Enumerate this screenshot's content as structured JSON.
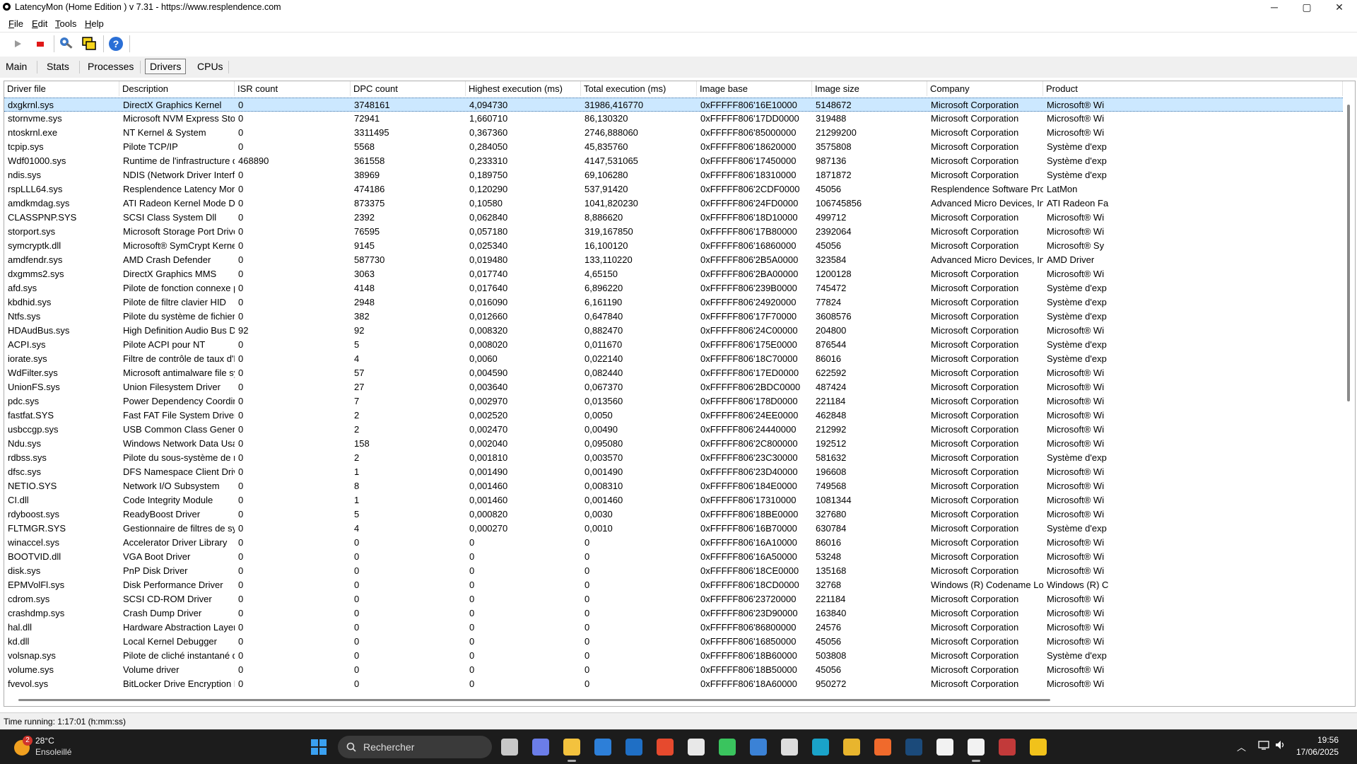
{
  "window": {
    "title": "LatencyMon  (Home Edition )  v 7.31 - https://www.resplendence.com",
    "minimize": "─",
    "maximize": "▢",
    "close": "✕"
  },
  "menu": [
    {
      "u": "F",
      "rest": "ile"
    },
    {
      "u": "E",
      "rest": "dit"
    },
    {
      "u": "T",
      "rest": "ools"
    },
    {
      "u": "H",
      "rest": "elp"
    }
  ],
  "toolbar": {
    "icons": [
      "play-icon",
      "stop-icon",
      "gear-wrench-icon",
      "copy-windows-icon",
      "help-icon"
    ]
  },
  "tabs": [
    {
      "label": "Main",
      "active": false
    },
    {
      "label": "Stats",
      "active": false
    },
    {
      "label": "Processes",
      "active": false
    },
    {
      "label": "Drivers",
      "active": true
    },
    {
      "label": "CPUs",
      "active": false
    }
  ],
  "columns": [
    "Driver file",
    "Description",
    "ISR count",
    "DPC count",
    "Highest execution (ms)",
    "Total execution (ms)",
    "Image base",
    "Image size",
    "Company",
    "Product"
  ],
  "rows": [
    [
      "dxgkrnl.sys",
      "DirectX Graphics Kernel",
      "0",
      "3748161",
      "4,094730",
      "31986,416770",
      "0xFFFFF806'16E10000",
      "5148672",
      "Microsoft Corporation",
      "Microsoft® Wi"
    ],
    [
      "stornvme.sys",
      "Microsoft NVM Express Storp...",
      "0",
      "72941",
      "1,660710",
      "86,130320",
      "0xFFFFF806'17DD0000",
      "319488",
      "Microsoft Corporation",
      "Microsoft® Wi"
    ],
    [
      "ntoskrnl.exe",
      "NT Kernel & System",
      "0",
      "3311495",
      "0,367360",
      "2746,888060",
      "0xFFFFF806'85000000",
      "21299200",
      "Microsoft Corporation",
      "Microsoft® Wi"
    ],
    [
      "tcpip.sys",
      "Pilote TCP/IP",
      "0",
      "5568",
      "0,284050",
      "45,835760",
      "0xFFFFF806'18620000",
      "3575808",
      "Microsoft Corporation",
      "Système d'exp"
    ],
    [
      "Wdf01000.sys",
      "Runtime de l'infrastructure de ...",
      "468890",
      "361558",
      "0,233310",
      "4147,531065",
      "0xFFFFF806'17450000",
      "987136",
      "Microsoft Corporation",
      "Système d'exp"
    ],
    [
      "ndis.sys",
      "NDIS (Network Driver Interface...",
      "0",
      "38969",
      "0,189750",
      "69,106280",
      "0xFFFFF806'18310000",
      "1871872",
      "Microsoft Corporation",
      "Système d'exp"
    ],
    [
      "rspLLL64.sys",
      "Resplendence Latency Monit...",
      "0",
      "474186",
      "0,120290",
      "537,91420",
      "0xFFFFF806'2CDF0000",
      "45056",
      "Resplendence Software Proje...",
      "LatMon"
    ],
    [
      "amdkmdag.sys",
      "ATI Radeon Kernel Mode Driver",
      "0",
      "873375",
      "0,10580",
      "1041,820230",
      "0xFFFFF806'24FD0000",
      "106745856",
      "Advanced Micro Devices, Inc.",
      "ATI Radeon Fa"
    ],
    [
      "CLASSPNP.SYS",
      "SCSI Class System Dll",
      "0",
      "2392",
      "0,062840",
      "8,886620",
      "0xFFFFF806'18D10000",
      "499712",
      "Microsoft Corporation",
      "Microsoft® Wi"
    ],
    [
      "storport.sys",
      "Microsoft Storage Port Driver",
      "0",
      "76595",
      "0,057180",
      "319,167850",
      "0xFFFFF806'17B80000",
      "2392064",
      "Microsoft Corporation",
      "Microsoft® Wi"
    ],
    [
      "symcryptk.dll",
      "Microsoft® SymCrypt Kernel ...",
      "0",
      "9145",
      "0,025340",
      "16,100120",
      "0xFFFFF806'16860000",
      "45056",
      "Microsoft Corporation",
      "Microsoft® Sy"
    ],
    [
      "amdfendr.sys",
      "AMD Crash Defender",
      "0",
      "587730",
      "0,019480",
      "133,110220",
      "0xFFFFF806'2B5A0000",
      "323584",
      "Advanced Micro Devices, Inc.",
      "AMD Driver"
    ],
    [
      "dxgmms2.sys",
      "DirectX Graphics MMS",
      "0",
      "3063",
      "0,017740",
      "4,65150",
      "0xFFFFF806'2BA00000",
      "1200128",
      "Microsoft Corporation",
      "Microsoft® Wi"
    ],
    [
      "afd.sys",
      "Pilote de fonction connexe po...",
      "0",
      "4148",
      "0,017640",
      "6,896220",
      "0xFFFFF806'239B0000",
      "745472",
      "Microsoft Corporation",
      "Système d'exp"
    ],
    [
      "kbdhid.sys",
      "Pilote de filtre clavier HID",
      "0",
      "2948",
      "0,016090",
      "6,161190",
      "0xFFFFF806'24920000",
      "77824",
      "Microsoft Corporation",
      "Système d'exp"
    ],
    [
      "Ntfs.sys",
      "Pilote du système de fichiers ...",
      "0",
      "382",
      "0,012660",
      "0,647840",
      "0xFFFFF806'17F70000",
      "3608576",
      "Microsoft Corporation",
      "Système d'exp"
    ],
    [
      "HDAudBus.sys",
      "High Definition Audio Bus Driver",
      "92",
      "92",
      "0,008320",
      "0,882470",
      "0xFFFFF806'24C00000",
      "204800",
      "Microsoft Corporation",
      "Microsoft® Wi"
    ],
    [
      "ACPI.sys",
      "Pilote ACPI pour NT",
      "0",
      "5",
      "0,008020",
      "0,011670",
      "0xFFFFF806'175E0000",
      "876544",
      "Microsoft Corporation",
      "Système d'exp"
    ],
    [
      "iorate.sys",
      "Filtre de contrôle de taux d'E/S",
      "0",
      "4",
      "0,0060",
      "0,022140",
      "0xFFFFF806'18C70000",
      "86016",
      "Microsoft Corporation",
      "Système d'exp"
    ],
    [
      "WdFilter.sys",
      "Microsoft antimalware file sys...",
      "0",
      "57",
      "0,004590",
      "0,082440",
      "0xFFFFF806'17ED0000",
      "622592",
      "Microsoft Corporation",
      "Microsoft® Wi"
    ],
    [
      "UnionFS.sys",
      "Union Filesystem Driver",
      "0",
      "27",
      "0,003640",
      "0,067370",
      "0xFFFFF806'2BDC0000",
      "487424",
      "Microsoft Corporation",
      "Microsoft® Wi"
    ],
    [
      "pdc.sys",
      "Power Dependency Coordinat...",
      "0",
      "7",
      "0,002970",
      "0,013560",
      "0xFFFFF806'178D0000",
      "221184",
      "Microsoft Corporation",
      "Microsoft® Wi"
    ],
    [
      "fastfat.SYS",
      "Fast FAT File System Driver",
      "0",
      "2",
      "0,002520",
      "0,0050",
      "0xFFFFF806'24EE0000",
      "462848",
      "Microsoft Corporation",
      "Microsoft® Wi"
    ],
    [
      "usbccgp.sys",
      "USB Common Class Generic ...",
      "0",
      "2",
      "0,002470",
      "0,00490",
      "0xFFFFF806'24440000",
      "212992",
      "Microsoft Corporation",
      "Microsoft® Wi"
    ],
    [
      "Ndu.sys",
      "Windows Network Data Usag...",
      "0",
      "158",
      "0,002040",
      "0,095080",
      "0xFFFFF806'2C800000",
      "192512",
      "Microsoft Corporation",
      "Microsoft® Wi"
    ],
    [
      "rdbss.sys",
      "Pilote du sous-système de mi...",
      "0",
      "2",
      "0,001810",
      "0,003570",
      "0xFFFFF806'23C30000",
      "581632",
      "Microsoft Corporation",
      "Système d'exp"
    ],
    [
      "dfsc.sys",
      "DFS Namespace Client Driver",
      "0",
      "1",
      "0,001490",
      "0,001490",
      "0xFFFFF806'23D40000",
      "196608",
      "Microsoft Corporation",
      "Microsoft® Wi"
    ],
    [
      "NETIO.SYS",
      "Network I/O Subsystem",
      "0",
      "8",
      "0,001460",
      "0,008310",
      "0xFFFFF806'184E0000",
      "749568",
      "Microsoft Corporation",
      "Microsoft® Wi"
    ],
    [
      "CI.dll",
      "Code Integrity Module",
      "0",
      "1",
      "0,001460",
      "0,001460",
      "0xFFFFF806'17310000",
      "1081344",
      "Microsoft Corporation",
      "Microsoft® Wi"
    ],
    [
      "rdyboost.sys",
      "ReadyBoost Driver",
      "0",
      "5",
      "0,000820",
      "0,0030",
      "0xFFFFF806'18BE0000",
      "327680",
      "Microsoft Corporation",
      "Microsoft® Wi"
    ],
    [
      "FLTMGR.SYS",
      "Gestionnaire de filtres de syst...",
      "0",
      "4",
      "0,000270",
      "0,0010",
      "0xFFFFF806'16B70000",
      "630784",
      "Microsoft Corporation",
      "Système d'exp"
    ],
    [
      "winaccel.sys",
      "Accelerator Driver Library",
      "0",
      "0",
      "0",
      "0",
      "0xFFFFF806'16A10000",
      "86016",
      "Microsoft Corporation",
      "Microsoft® Wi"
    ],
    [
      "BOOTVID.dll",
      "VGA Boot Driver",
      "0",
      "0",
      "0",
      "0",
      "0xFFFFF806'16A50000",
      "53248",
      "Microsoft Corporation",
      "Microsoft® Wi"
    ],
    [
      "disk.sys",
      "PnP Disk Driver",
      "0",
      "0",
      "0",
      "0",
      "0xFFFFF806'18CE0000",
      "135168",
      "Microsoft Corporation",
      "Microsoft® Wi"
    ],
    [
      "EPMVolFl.sys",
      "Disk Performance Driver",
      "0",
      "0",
      "0",
      "0",
      "0xFFFFF806'18CD0000",
      "32768",
      "Windows (R) Codename Long...",
      "Windows (R) C"
    ],
    [
      "cdrom.sys",
      "SCSI CD-ROM Driver",
      "0",
      "0",
      "0",
      "0",
      "0xFFFFF806'23720000",
      "221184",
      "Microsoft Corporation",
      "Microsoft® Wi"
    ],
    [
      "crashdmp.sys",
      "Crash Dump Driver",
      "0",
      "0",
      "0",
      "0",
      "0xFFFFF806'23D90000",
      "163840",
      "Microsoft Corporation",
      "Microsoft® Wi"
    ],
    [
      "hal.dll",
      "Hardware Abstraction Layer DLL",
      "0",
      "0",
      "0",
      "0",
      "0xFFFFF806'86800000",
      "24576",
      "Microsoft Corporation",
      "Microsoft® Wi"
    ],
    [
      "kd.dll",
      "Local Kernel Debugger",
      "0",
      "0",
      "0",
      "0",
      "0xFFFFF806'16850000",
      "45056",
      "Microsoft Corporation",
      "Microsoft® Wi"
    ],
    [
      "volsnap.sys",
      "Pilote de cliché instantané du...",
      "0",
      "0",
      "0",
      "0",
      "0xFFFFF806'18B60000",
      "503808",
      "Microsoft Corporation",
      "Système d'exp"
    ],
    [
      "volume.sys",
      "Volume driver",
      "0",
      "0",
      "0",
      "0",
      "0xFFFFF806'18B50000",
      "45056",
      "Microsoft Corporation",
      "Microsoft® Wi"
    ],
    [
      "fvevol.sys",
      "BitLocker Drive Encryption Dri...",
      "0",
      "0",
      "0",
      "0",
      "0xFFFFF806'18A60000",
      "950272",
      "Microsoft Corporation",
      "Microsoft® Wi"
    ]
  ],
  "selected_row": 0,
  "status": {
    "text": "Time running: 1:17:01  (h:mm:ss)"
  },
  "taskbar": {
    "weather": {
      "badge": "2",
      "temp": "28°C",
      "condition": "Ensoleillé"
    },
    "search_placeholder": "Rechercher",
    "apps": [
      {
        "name": "task-view",
        "color": "#c8c8c8",
        "running": false
      },
      {
        "name": "copilot",
        "color": "#6b7de8",
        "running": false
      },
      {
        "name": "file-explorer",
        "color": "#f3c23e",
        "running": true
      },
      {
        "name": "defender",
        "color": "#2d7fd8",
        "running": false
      },
      {
        "name": "outlook",
        "color": "#1f6fc5",
        "running": false
      },
      {
        "name": "office",
        "color": "#e64a2e",
        "running": false
      },
      {
        "name": "ms-store",
        "color": "#e8e8e8",
        "running": false
      },
      {
        "name": "whatsapp",
        "color": "#3ac45e",
        "running": false
      },
      {
        "name": "calculator",
        "color": "#3b82d6",
        "running": false
      },
      {
        "name": "perplexity",
        "color": "#dddddd",
        "running": false
      },
      {
        "name": "edge",
        "color": "#1aa3c9",
        "running": false
      },
      {
        "name": "chrome",
        "color": "#e8b52e",
        "running": false
      },
      {
        "name": "firefox",
        "color": "#f06a2c",
        "running": false
      },
      {
        "name": "steam",
        "color": "#1b4a7a",
        "running": false
      },
      {
        "name": "clock",
        "color": "#f2f2f2",
        "running": false
      },
      {
        "name": "latencymon",
        "color": "#f2f2f2",
        "running": true
      },
      {
        "name": "app-red",
        "color": "#c23a3a",
        "running": false
      },
      {
        "name": "app-x",
        "color": "#f1c21b",
        "running": false
      }
    ],
    "tray_chevron": "︿",
    "time": "19:56",
    "date": "17/06/2025"
  }
}
